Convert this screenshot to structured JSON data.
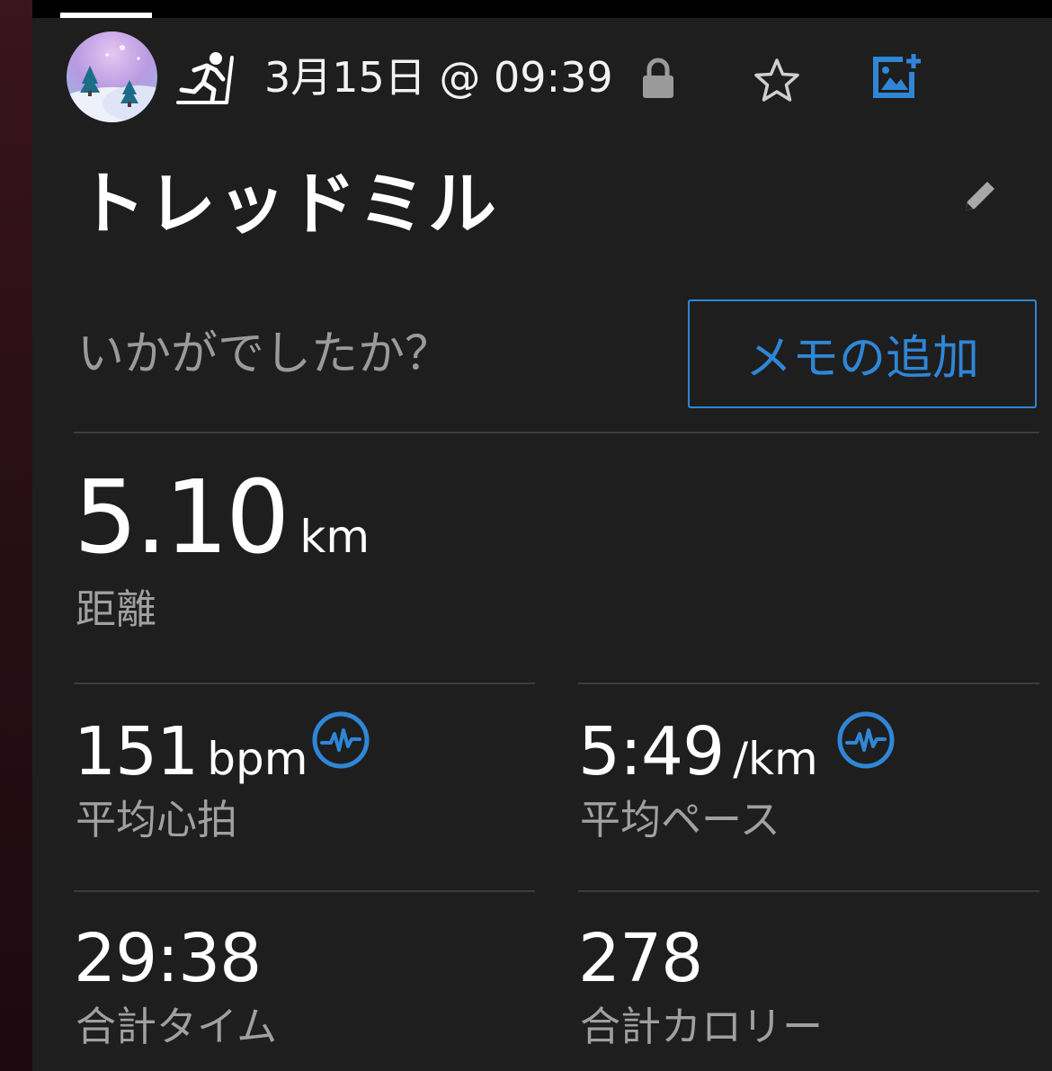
{
  "header": {
    "date_time": "3月15日 @ 09:39",
    "activity_icon": "treadmill-running-icon",
    "privacy_icon": "lock-icon",
    "favorite_icon": "star-icon",
    "add_photo_icon": "add-photo-icon"
  },
  "activity": {
    "title": "トレッドミル",
    "edit_icon": "pencil-icon"
  },
  "feedback": {
    "prompt": "いかがでしたか？",
    "memo_button_label": "メモの追加"
  },
  "distance": {
    "value": "5.10",
    "unit": "km",
    "label": "距離"
  },
  "stats": [
    {
      "value": "151",
      "unit": "bpm",
      "label": "平均心拍",
      "icon": "heart-rate-chart-icon"
    },
    {
      "value": "5:49",
      "unit": "/km",
      "label": "平均ペース",
      "icon": "pace-chart-icon"
    },
    {
      "value": "29:38",
      "unit": "",
      "label": "合計タイム"
    },
    {
      "value": "278",
      "unit": "",
      "label": "合計カロリー"
    }
  ],
  "colors": {
    "accent": "#2f86d6",
    "background": "#1e1e1e",
    "secondary_text": "#a0a0a0"
  }
}
